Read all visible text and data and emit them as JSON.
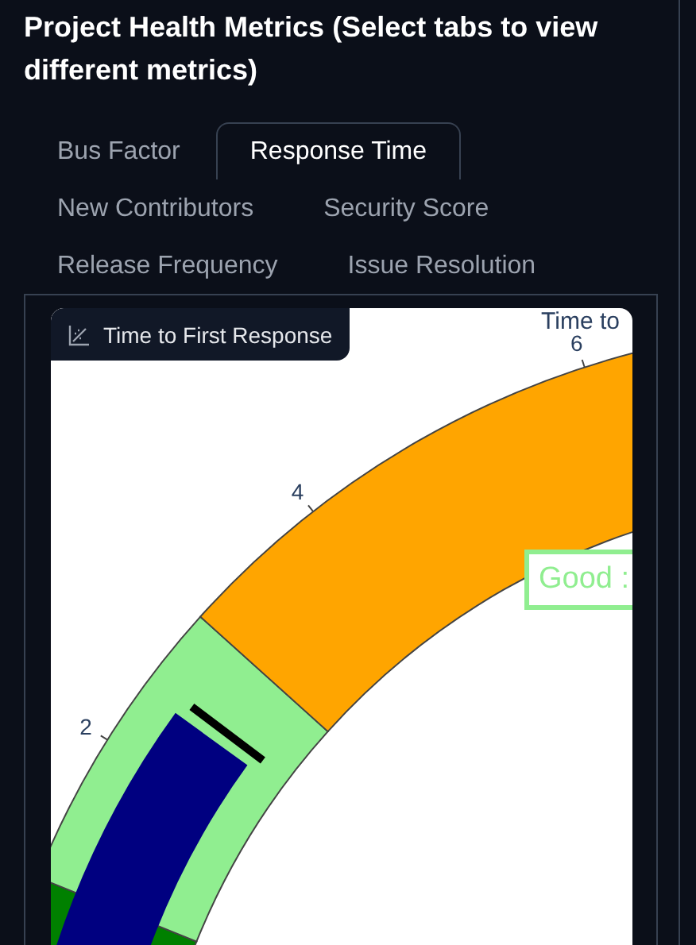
{
  "heading": "Project Health Metrics (Select tabs to view different metrics)",
  "tabs": [
    {
      "label": "Bus Factor",
      "selected": false
    },
    {
      "label": "Response Time",
      "selected": true
    },
    {
      "label": "New Contributors",
      "selected": false
    },
    {
      "label": "Security Score",
      "selected": false
    },
    {
      "label": "Release Frequency",
      "selected": false
    },
    {
      "label": "Issue Resolution",
      "selected": false
    }
  ],
  "plot": {
    "toolbar_label": "Time to First Response",
    "title": "Time to",
    "gauge": {
      "ticks": [
        "2",
        "4",
        "6"
      ],
      "steps": [
        {
          "color": "#008000"
        },
        {
          "color": "#90ee90"
        },
        {
          "color": "#ffa500"
        }
      ],
      "annotation": "Good :"
    }
  }
}
